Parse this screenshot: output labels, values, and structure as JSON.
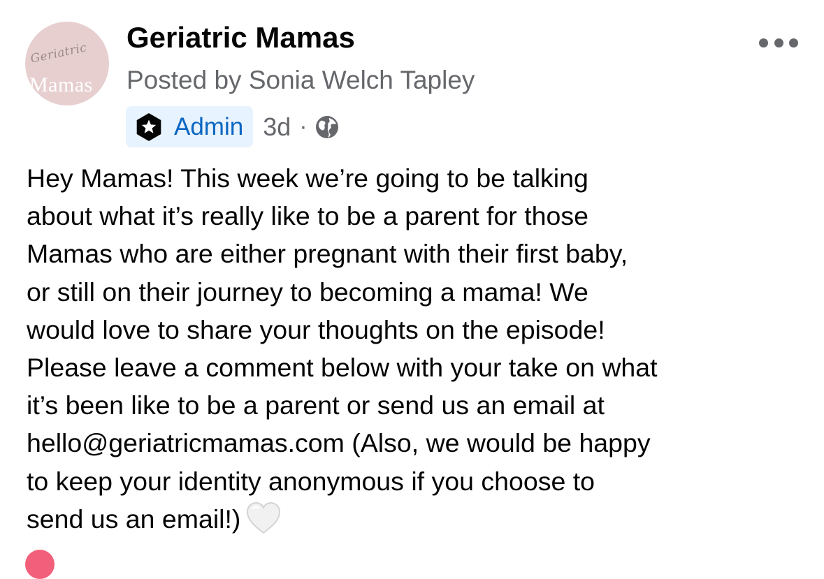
{
  "post": {
    "group_name": "Geriatric Mamas",
    "avatar_logo_text": "Geriatric Mamas",
    "posted_by": "Posted by Sonia Welch Tapley",
    "badge_label": "Admin",
    "timestamp": "3d",
    "separator": "·",
    "privacy_icon": "globe-icon",
    "more_icon": "more-options-icon",
    "body_lines": [
      "Hey Mamas! This week we’re going to be talking",
      "about what it’s really like to be a parent for those",
      "Mamas who are either pregnant with their first baby,",
      "or still on their journey to becoming a mama! We",
      "would love to share your thoughts on the episode!",
      "Please leave a comment below with your take on what",
      "it’s been like to be a parent or send us an email at",
      "hello@geriatricmamas.com (Also, we would be happy",
      "to keep your identity anonymous if you choose to",
      "send us an email!)"
    ],
    "trailing_emoji": "white-heart-emoji"
  },
  "colors": {
    "avatar_bg": "#e7cfd0",
    "badge_bg": "#e7f3ff",
    "badge_text": "#0a66c2",
    "secondary_text": "#65676b",
    "primary_text": "#050505",
    "reaction": "#f25f7a"
  }
}
